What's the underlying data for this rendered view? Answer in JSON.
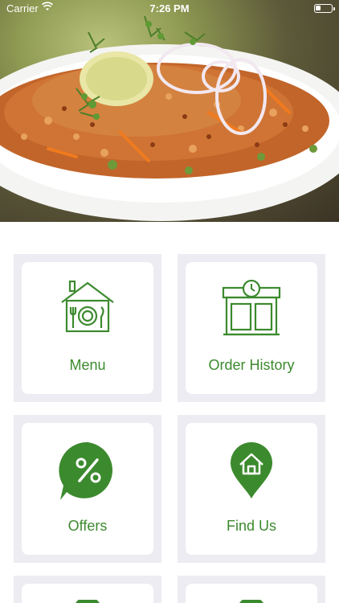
{
  "status_bar": {
    "carrier": "Carrier",
    "time": "7:26 PM"
  },
  "theme": {
    "accent": "#3c8a2e",
    "tile_background": "#ececf2"
  },
  "tiles": [
    {
      "label": "Menu",
      "icon": "house-plate-icon"
    },
    {
      "label": "Order History",
      "icon": "shop-clock-icon"
    },
    {
      "label": "Offers",
      "icon": "percent-bubble-icon"
    },
    {
      "label": "Find Us",
      "icon": "map-pin-home-icon"
    }
  ]
}
